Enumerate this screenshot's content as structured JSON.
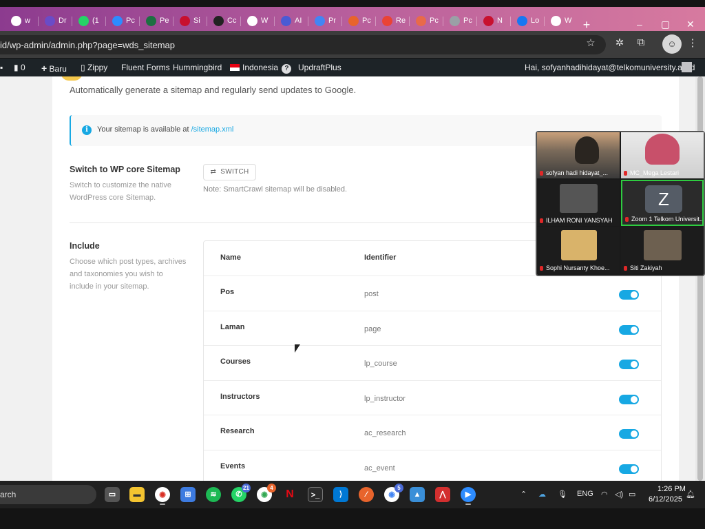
{
  "browser": {
    "tabs": [
      {
        "label": "w",
        "icon": "google-icon",
        "color": "#ffffff"
      },
      {
        "label": "Dr",
        "icon": "app-icon",
        "color": "#6a4cc7"
      },
      {
        "label": "(1",
        "icon": "whatsapp-icon",
        "color": "#25d366"
      },
      {
        "label": "Pc",
        "icon": "zoom-icon",
        "color": "#2d8cff"
      },
      {
        "label": "Pe",
        "icon": "excel-icon",
        "color": "#1d6f42"
      },
      {
        "label": "Si",
        "icon": "telkom-icon",
        "color": "#c8102e"
      },
      {
        "label": "Cc",
        "icon": "github-icon",
        "color": "#222222"
      },
      {
        "label": "W",
        "icon": "wordpress-icon",
        "color": "#ffffff"
      },
      {
        "label": "AI",
        "icon": "ai-icon",
        "color": "#4a5bd4"
      },
      {
        "label": "Pr",
        "icon": "docs-icon",
        "color": "#4285f4"
      },
      {
        "label": "Pc",
        "icon": "orange-icon",
        "color": "#e8642c"
      },
      {
        "label": "Re",
        "icon": "gmail-icon",
        "color": "#ea4335"
      },
      {
        "label": "Pc",
        "icon": "orange2-icon",
        "color": "#e86a4a"
      },
      {
        "label": "Pc",
        "icon": "gray-icon",
        "color": "#9aa0a6"
      },
      {
        "label": "N",
        "icon": "telkom-icon",
        "color": "#c8102e"
      },
      {
        "label": "Lo",
        "icon": "facebook-icon",
        "color": "#1877f2"
      },
      {
        "label": "W",
        "icon": "ring-icon",
        "color": "#ffffff"
      }
    ],
    "new_tab": "+",
    "url": "id/wp-admin/admin.php?page=wds_sitemap"
  },
  "wpbar": {
    "comments": "0",
    "new": "Baru",
    "zippy": "Zippy",
    "fluent": "Fluent Forms",
    "hummingbird": "Hummingbird",
    "language": "Indonesia",
    "updraft": "UpdraftPlus",
    "greeting": "Hai, sofyanhadihidayat@telkomuniversity.ac.id"
  },
  "page": {
    "intro": "Automatically generate a sitemap and regularly send updates to Google.",
    "notice_text": "Your sitemap is available at ",
    "notice_link": "/sitemap.xml",
    "switch": {
      "title": "Switch to WP core Sitemap",
      "desc": "Switch to customize the native WordPress core Sitemap.",
      "button": "SWITCH",
      "note": "Note: SmartCrawl sitemap will be disabled."
    },
    "include": {
      "title": "Include",
      "desc": "Choose which post types, archives and taxonomies you wish to include in your sitemap.",
      "col_name": "Name",
      "col_identifier": "Identifier",
      "rows": [
        {
          "name": "Pos",
          "id": "post",
          "enabled": true
        },
        {
          "name": "Laman",
          "id": "page",
          "enabled": true
        },
        {
          "name": "Courses",
          "id": "lp_course",
          "enabled": true
        },
        {
          "name": "Instructors",
          "id": "lp_instructor",
          "enabled": true
        },
        {
          "name": "Research",
          "id": "ac_research",
          "enabled": true
        },
        {
          "name": "Events",
          "id": "ac_event",
          "enabled": true
        }
      ]
    }
  },
  "zoom": {
    "participants": [
      "sofyan hadi hidayat_...",
      "MC_Mega Lestari",
      "ILHAM RONI YANSYAH",
      "Zoom 1 Telkom Universit...",
      "Sophi Nursanty Khoe...",
      "Siti Zakiyah"
    ],
    "active_letter": "Z"
  },
  "taskbar": {
    "search": "arch",
    "whatsapp_badge": "21",
    "chrome_badge": "4",
    "chrome2_badge": "5",
    "lang": "ENG",
    "time": "1:26 PM",
    "date": "6/12/2025"
  }
}
